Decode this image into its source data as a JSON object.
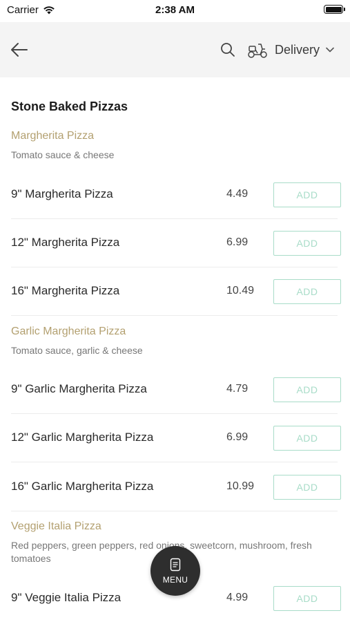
{
  "status_bar": {
    "carrier": "Carrier",
    "time": "2:38 AM"
  },
  "nav": {
    "delivery_label": "Delivery"
  },
  "section": {
    "title": "Stone Baked Pizzas"
  },
  "groups": [
    {
      "name": "Margherita Pizza",
      "description": "Tomato sauce & cheese",
      "items": [
        {
          "name": "9\" Margherita Pizza",
          "price": "4.49",
          "action": "ADD"
        },
        {
          "name": "12\" Margherita Pizza",
          "price": "6.99",
          "action": "ADD"
        },
        {
          "name": "16\" Margherita Pizza",
          "price": "10.49",
          "action": "ADD"
        }
      ]
    },
    {
      "name": "Garlic Margherita Pizza",
      "description": "Tomato sauce, garlic & cheese",
      "items": [
        {
          "name": "9\" Garlic Margherita Pizza",
          "price": "4.79",
          "action": "ADD"
        },
        {
          "name": "12\" Garlic Margherita Pizza",
          "price": "6.99",
          "action": "ADD"
        },
        {
          "name": "16\" Garlic Margherita Pizza",
          "price": "10.99",
          "action": "ADD"
        }
      ]
    },
    {
      "name": "Veggie Italia Pizza",
      "description": "Red peppers, green peppers, red onions, sweetcorn, mushroom, fresh tomatoes",
      "items": [
        {
          "name": "9\" Veggie Italia Pizza",
          "price": "4.99",
          "action": "ADD"
        }
      ]
    }
  ],
  "fab": {
    "label": "MENU"
  },
  "colors": {
    "accent_gold": "#b3a070",
    "add_green": "#a8dcc8",
    "nav_bg": "#f4f4f4",
    "fab_bg": "#2e2e2e"
  },
  "icons": [
    "wifi-icon",
    "battery-icon",
    "back-arrow-icon",
    "search-icon",
    "scooter-icon",
    "chevron-down-icon",
    "menu-doc-icon"
  ]
}
